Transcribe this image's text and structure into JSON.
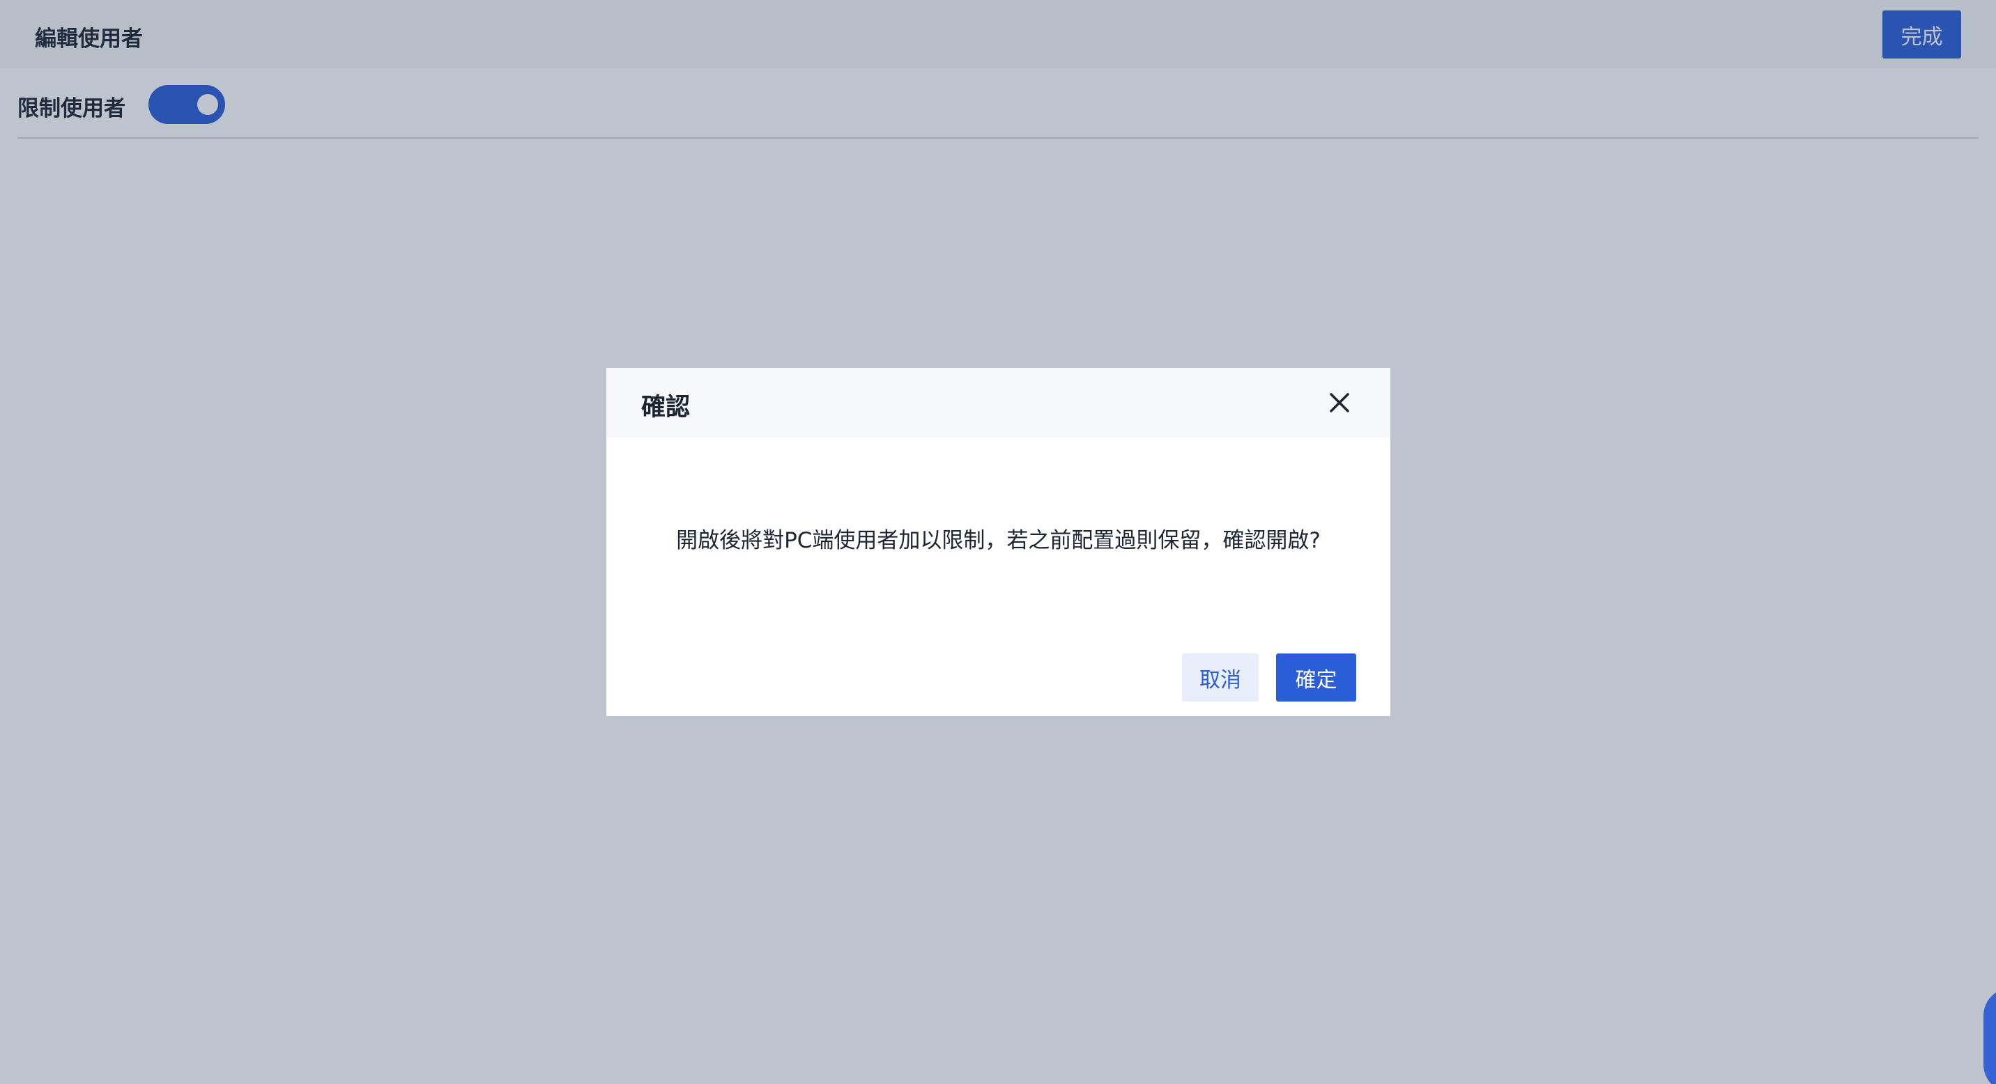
{
  "header": {
    "title": "編輯使用者",
    "done_label": "完成"
  },
  "restrict": {
    "label": "限制使用者",
    "enabled": true
  },
  "dialog": {
    "title": "確認",
    "message": "開啟後將對PC端使用者加以限制，若之前配置過則保留，確認開啟?",
    "cancel_label": "取消",
    "ok_label": "確定",
    "close_icon": "close-icon"
  },
  "colors": {
    "accent": "#2b5dd9",
    "cancel_bg": "#e8eefc",
    "text": "#1d2533",
    "mask": "rgba(40,60,90,0.30)"
  }
}
